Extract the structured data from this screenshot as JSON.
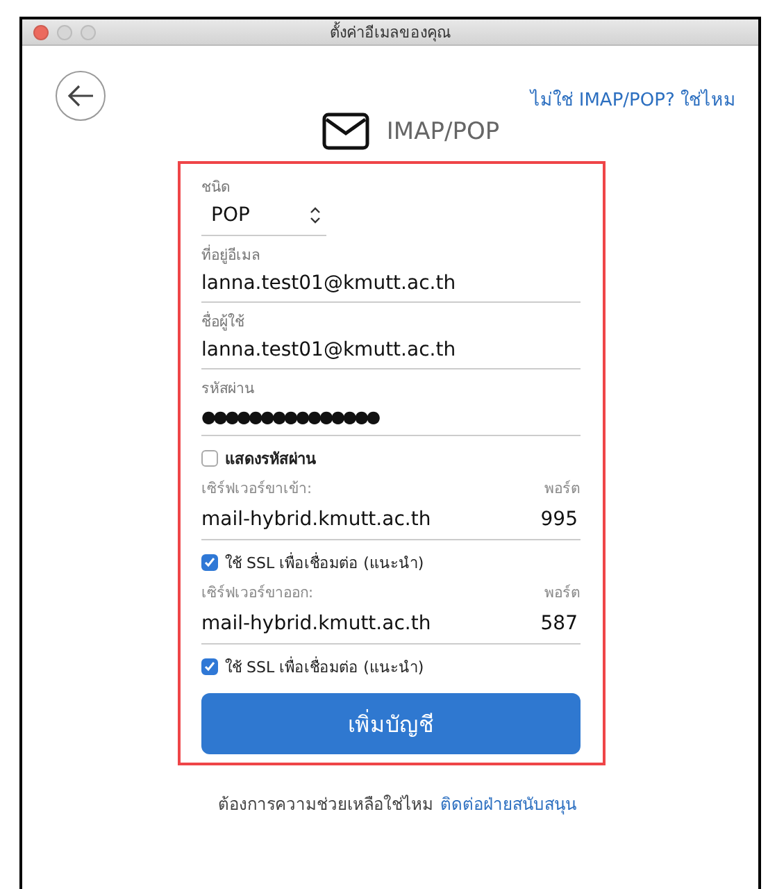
{
  "window": {
    "title": "ตั้งค่าอีเมลของคุณ"
  },
  "header": {
    "link": "ไม่ใช่ IMAP/POP? ใช่ไหม",
    "title": "IMAP/POP"
  },
  "form": {
    "type": {
      "label": "ชนิด",
      "value": "POP"
    },
    "fields": [
      {
        "label": "ที่อยู่อีเมล",
        "value": "lanna.test01@kmutt.ac.th",
        "kind": "text"
      },
      {
        "label": "ชื่อผู้ใช้",
        "value": "lanna.test01@kmutt.ac.th",
        "kind": "text"
      },
      {
        "label": "รหัสผ่าน",
        "value": "●●●●●●●●●●●●●●●",
        "kind": "password"
      }
    ],
    "show_password": {
      "label": "แสดงรหัสผ่าน",
      "checked": false
    },
    "servers": [
      {
        "label": "เซิร์ฟเวอร์ขาเข้า:",
        "port_label": "พอร์ต",
        "host": "mail-hybrid.kmutt.ac.th",
        "port": "995",
        "ssl": {
          "label": "ใช้ SSL เพื่อเชื่อมต่อ (แนะนำ)",
          "checked": true
        }
      },
      {
        "label": "เซิร์ฟเวอร์ขาออก:",
        "port_label": "พอร์ต",
        "host": "mail-hybrid.kmutt.ac.th",
        "port": "587",
        "ssl": {
          "label": "ใช้ SSL เพื่อเชื่อมต่อ (แนะนำ)",
          "checked": true
        }
      }
    ],
    "submit": "เพิ่มบัญชี"
  },
  "footer": {
    "text": "ต้องการความช่วยเหลือใช่ไหม",
    "link": "ติดต่อฝ่ายสนับสนุน"
  }
}
